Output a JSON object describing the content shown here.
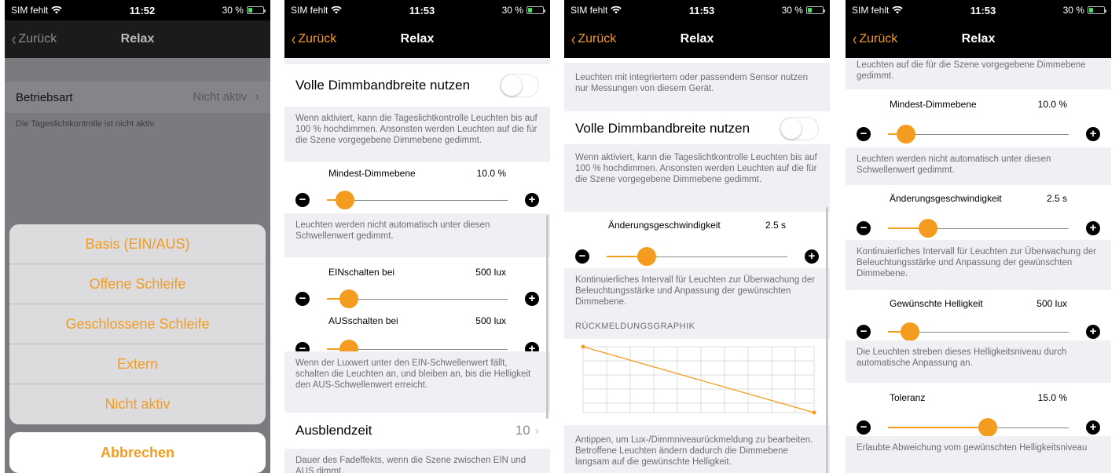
{
  "status": {
    "carrier": "SIM fehlt",
    "battery": "30 %"
  },
  "phones": [
    {
      "time": "11:52",
      "nav": {
        "back": "Zurück",
        "title": "Relax"
      },
      "betriebsart": {
        "label": "Betriebsart",
        "value": "Nicht aktiv"
      },
      "info": "Die Tageslichtkontrolle ist nicht aktiv.",
      "sheet": {
        "options": [
          "Basis (EIN/AUS)",
          "Offene Schleife",
          "Geschlossene Schleife",
          "Extern",
          "Nicht aktiv"
        ],
        "cancel": "Abbrechen"
      }
    },
    {
      "time": "11:53",
      "nav": {
        "back": "Zurück",
        "title": "Relax"
      },
      "full_dim": {
        "label": "Volle Dimmbandbreite nutzen",
        "on": false
      },
      "full_dim_desc": "Wenn aktiviert, kann die Tageslichtkontrolle Leuchten bis auf 100 % hochdimmen. Ansonsten werden Leuchten auf die für die Szene vorgegebene Dimmebene gedimmt.",
      "min_dim": {
        "label": "Mindest-Dimmebene",
        "value": "10.0 %",
        "level": 0.1
      },
      "min_dim_desc": "Leuchten werden nicht automatisch unter diesen Schwellenwert gedimmt.",
      "on_at": {
        "label": "EINschalten bei",
        "value": "500 lux",
        "level": 0.12
      },
      "off_at": {
        "label": "AUSschalten bei",
        "value": "500 lux",
        "level": 0.12
      },
      "switch_desc": "Wenn der Luxwert unter den EIN-Schwellenwert fällt, schalten die Leuchten an, und bleiben an, bis die Helligkeit den AUS-Schwellenwert erreicht.",
      "fade": {
        "label": "Ausblendzeit",
        "value": "10"
      },
      "fade_desc": "Dauer des Fadeffekts, wenn die Szene zwischen EIN und AUS dimmt."
    },
    {
      "time": "11:53",
      "nav": {
        "back": "Zurück",
        "title": "Relax"
      },
      "sensor_desc": "Leuchten mit integriertem oder passendem Sensor nutzen nur Messungen von diesem Gerät.",
      "full_dim": {
        "label": "Volle Dimmbandbreite nutzen",
        "on": false
      },
      "full_dim_desc": "Wenn aktiviert, kann die Tageslichtkontrolle Leuchten bis auf 100 % hochdimmen. Ansonsten werden Leuchten auf die für die Szene vorgegebene Dimmebene gedimmt.",
      "rate": {
        "label": "Änderungsgeschwindigkeit",
        "value": "2.5 s",
        "level": 0.22
      },
      "rate_desc": "Kontinuierliches Intervall für Leuchten zur Überwachung der Beleuchtungsstärke und Anpassung der gewünschten Dimmebene.",
      "graph_title": "RÜCKMELDUNGSGRAPHIK",
      "graph_desc": "Antippen, um Lux-/Dimmniveaurückmeldung zu bearbeiten. Betroffene Leuchten ändern dadurch die Dimmebene langsam auf die gewünschte Helligkeit."
    },
    {
      "time": "11:53",
      "nav": {
        "back": "Zurück",
        "title": "Relax"
      },
      "top_desc": "Leuchten auf die für die Szene vorgegebene Dimmebene gedimmt.",
      "min_dim": {
        "label": "Mindest-Dimmebene",
        "value": "10.0 %",
        "level": 0.1
      },
      "min_dim_desc": "Leuchten werden nicht automatisch unter diesen Schwellenwert gedimmt.",
      "rate": {
        "label": "Änderungsgeschwindigkeit",
        "value": "2.5 s",
        "level": 0.22
      },
      "rate_desc": "Kontinuierliches Intervall für Leuchten zur Überwachung der Beleuchtungsstärke und Anpassung der gewünschten Dimmebene.",
      "brightness": {
        "label": "Gewünschte Helligkeit",
        "value": "500 lux",
        "level": 0.12
      },
      "brightness_desc": "Die Leuchten streben dieses Helligkeitsniveau durch automatische Anpassung an.",
      "tolerance": {
        "label": "Toleranz",
        "value": "15.0 %",
        "level": 0.55
      },
      "tolerance_desc": "Erlaubte Abweichung vom gewünschten Helligkeitsniveau"
    }
  ],
  "colors": {
    "accent": "#f39c1f",
    "nav_bg": "#000000",
    "group_bg": "#efeff4"
  }
}
